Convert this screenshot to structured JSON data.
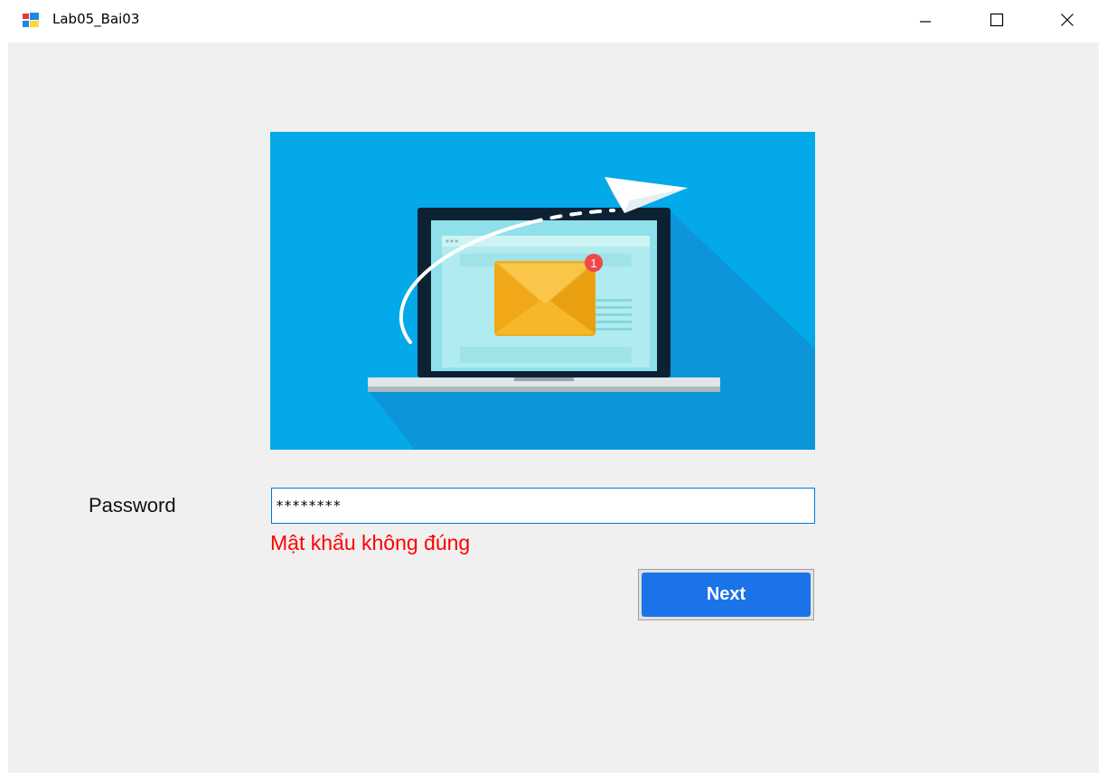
{
  "window": {
    "title": "Lab05_Bai03",
    "app_icon": "winforms-app-icon",
    "minimize_icon": "minimize-icon",
    "maximize_icon": "maximize-icon",
    "close_icon": "close-icon"
  },
  "form": {
    "password_label": "Password",
    "password_value": "********",
    "error_message": "Mật khẩu không đúng",
    "next_label": "Next"
  },
  "illustration": {
    "description_icon": "laptop-email-illustration",
    "notification_badge": "1"
  },
  "colors": {
    "hero_background": "#03a9e8",
    "error": "#ff0000",
    "next_button": "#1a73e8",
    "input_border": "#0078d7",
    "client_background": "#f0f0f0"
  }
}
